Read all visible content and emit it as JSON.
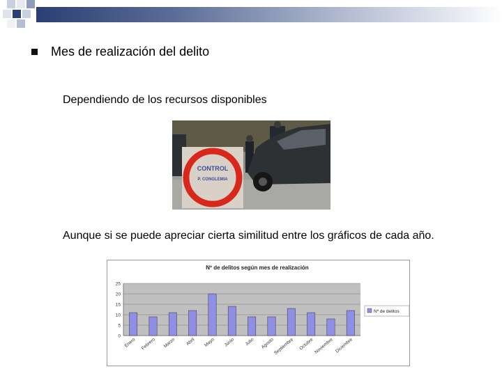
{
  "slide": {
    "bullet_text": "Mes de realización del delito",
    "subtext_1": "Dependiendo de los recursos disponibles",
    "subtext_2": "Aunque si se puede apreciar cierta similitud entre los gráficos de cada año."
  },
  "photo": {
    "sign_line_1": "CONTROL",
    "sign_line_2": "P. CONGLEMIA"
  },
  "colors": {
    "header_dark": "#2a3f73",
    "bar_fill": "#8f8fe6",
    "plot_background": "#c0c0c0",
    "sign_red": "#d8281c"
  },
  "chart_data": {
    "type": "bar",
    "title": "Nº de delitos según mes de realización",
    "categories": [
      "Enero",
      "Febrero",
      "Marzo",
      "Abril",
      "Mayo",
      "Junio",
      "Julio",
      "Agosto",
      "Septiembre",
      "Octubre",
      "Noviembre",
      "Diciembre"
    ],
    "series": [
      {
        "name": "Nº de delitos",
        "values": [
          11,
          9,
          11,
          12,
          20,
          14,
          9,
          9,
          13,
          11,
          8,
          12
        ]
      }
    ],
    "ylim": [
      0,
      25
    ],
    "yticks": [
      "0",
      "5",
      "10",
      "15",
      "20",
      "25"
    ],
    "grid": true,
    "legend_position": "right"
  }
}
